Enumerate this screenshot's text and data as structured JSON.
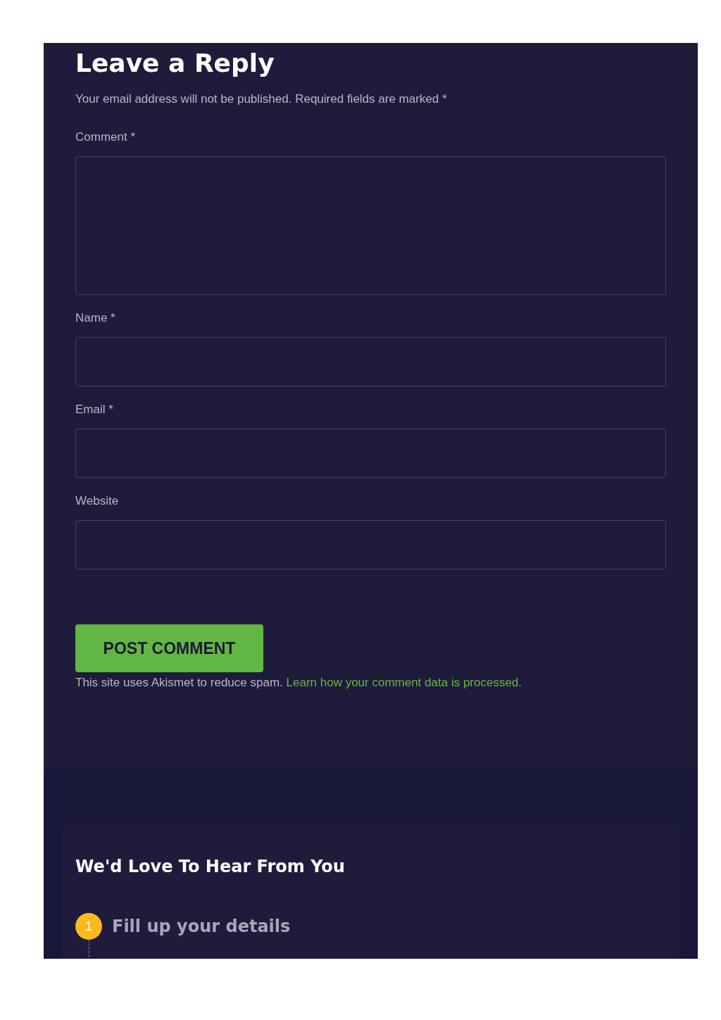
{
  "reply": {
    "title": "Leave a Reply",
    "notice": "Your email address will not be published. Required fields are marked *",
    "fields": [
      {
        "label": "Comment *",
        "kind": "textarea"
      },
      {
        "label": "Name *",
        "kind": "input"
      },
      {
        "label": "Email *",
        "kind": "input"
      },
      {
        "label": "Website",
        "kind": "input"
      }
    ],
    "button": "POST COMMENT",
    "spam_note": "This site uses Akismet to reduce spam.",
    "spam_link": "Learn how your comment data is processed."
  },
  "contact": {
    "title": "We'd Love To Hear From You",
    "steps": [
      {
        "number": "1",
        "label": "Fill up your details"
      }
    ]
  }
}
